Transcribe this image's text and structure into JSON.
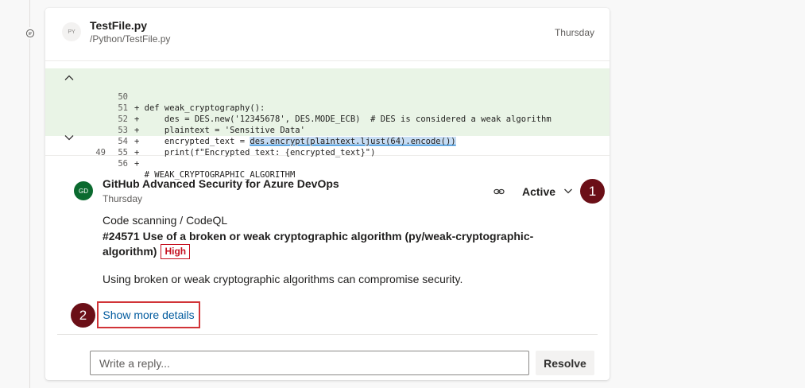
{
  "file": {
    "avatar_text": "PY",
    "name": "TestFile.py",
    "path": "/Python/TestFile.py",
    "date": "Thursday"
  },
  "code": {
    "lines": [
      {
        "old": "",
        "new": "50",
        "text": "+ def weak_cryptography():"
      },
      {
        "old": "",
        "new": "51",
        "text": "+     des = DES.new('12345678', DES.MODE_ECB)  # DES is considered a weak algorithm"
      },
      {
        "old": "",
        "new": "52",
        "text": "+     plaintext = 'Sensitive Data'"
      },
      {
        "old": "",
        "new": "53",
        "text_prefix": "+     encrypted_text = ",
        "text_highlight": "des.encrypt(plaintext.ljust(64).encode())"
      },
      {
        "old": "",
        "new": "54",
        "text": "+     print(f\"Encrypted text: {encrypted_text}\")"
      },
      {
        "old": "",
        "new": "55",
        "text": "+"
      },
      {
        "old": "49",
        "new": "56",
        "text": "  # WEAK_CRYPTOGRAPHIC_ALGORITHM"
      }
    ],
    "added_color": "#e9f4e6"
  },
  "comment": {
    "avatar_text": "GD",
    "author": "GitHub Advanced Security for Azure DevOps",
    "date": "Thursday",
    "status": "Active",
    "source": "Code scanning / CodeQL",
    "title": "#24571 Use of a broken or weak cryptographic algorithm (py/weak-cryptographic-algorithm)",
    "severity": "High",
    "description": "Using broken or weak cryptographic algorithms can compromise security.",
    "more_link": "Show more details"
  },
  "reply": {
    "placeholder": "Write a reply...",
    "resolve_label": "Resolve"
  },
  "callouts": {
    "one": "1",
    "two": "2"
  },
  "colors": {
    "callout": "#6b0f17",
    "severity": "#c50f1f",
    "link": "#005a9e"
  }
}
